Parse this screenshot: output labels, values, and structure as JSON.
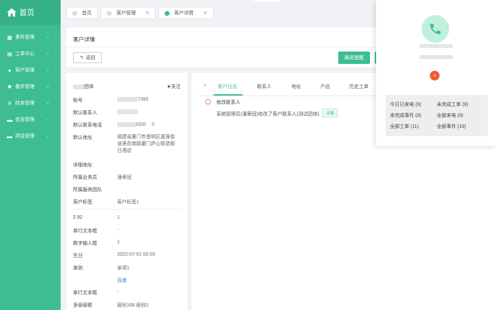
{
  "sidebar": {
    "logo": "首页",
    "items": [
      {
        "label": "事件管理"
      },
      {
        "label": "工单中心"
      },
      {
        "label": "客户管理"
      },
      {
        "label": "备件管理"
      },
      {
        "label": "财务管理"
      },
      {
        "label": "信息管理"
      },
      {
        "label": "项目管理"
      }
    ]
  },
  "tabs": [
    {
      "label": "首页"
    },
    {
      "label": "客户管理"
    },
    {
      "label": "客户详情"
    }
  ],
  "header": {
    "title": "客户详情",
    "back_label": "返回",
    "follow_reminder_label": "跟进提醒"
  },
  "info": {
    "name_suffix": "团体",
    "follow_label": "★关注",
    "rows": [
      {
        "label": "账号",
        "value_suffix": "7395"
      },
      {
        "label": "默认联系人",
        "value_suffix": ""
      },
      {
        "label": "默认联系电话",
        "value_suffix": "3320"
      },
      {
        "label": "默认地址",
        "value": "福建省厦门市思明区嘉莲街道莲花南路厦门庐山智选假日酒店"
      },
      {
        "label": "详细地址",
        "value": ""
      },
      {
        "label": "所属业务员",
        "value": "潘荣冠"
      },
      {
        "label": "所属服务团队",
        "value": ""
      },
      {
        "label": "客户标签",
        "value": "客户标签1"
      }
    ],
    "custom_rows": [
      {
        "label": "2.92",
        "value": "1"
      },
      {
        "label": "单行文本框",
        "value": "-"
      },
      {
        "label": "数字输入框",
        "value": "1"
      },
      {
        "label": "生日",
        "value": "2022-07-01 00:00"
      },
      {
        "label": "单则",
        "value": "单项1"
      },
      {
        "label": "",
        "value": "百度"
      },
      {
        "label": "单行文本框",
        "value": "-"
      },
      {
        "label": "多级级联",
        "value": "级别168 级别2"
      }
    ]
  },
  "main": {
    "back_arrow": "‹",
    "subtabs": [
      {
        "label": "客户日志"
      },
      {
        "label": "联系人"
      },
      {
        "label": "地址"
      },
      {
        "label": "产品"
      },
      {
        "label": "历史工单"
      }
    ],
    "log": {
      "title": "修改联系人",
      "desc": "系统管理员(潘荣冠)修改了客户联系人(测试团体)",
      "detail_label": "详情"
    }
  },
  "popup": {
    "hangup_symbol": "×",
    "stats": [
      {
        "label": "今日已来电",
        "count": "(8)"
      },
      {
        "label": "未完成工单",
        "count": "(9)"
      },
      {
        "label": "未完成事件",
        "count": "(8)"
      },
      {
        "label": "全部来电",
        "count": "(9)"
      },
      {
        "label": "全部工单",
        "count": "(11)"
      },
      {
        "label": "全部事件",
        "count": "(19)"
      }
    ]
  },
  "colors": {
    "brand": "#3dbd91",
    "hangup": "#f05a2a"
  }
}
